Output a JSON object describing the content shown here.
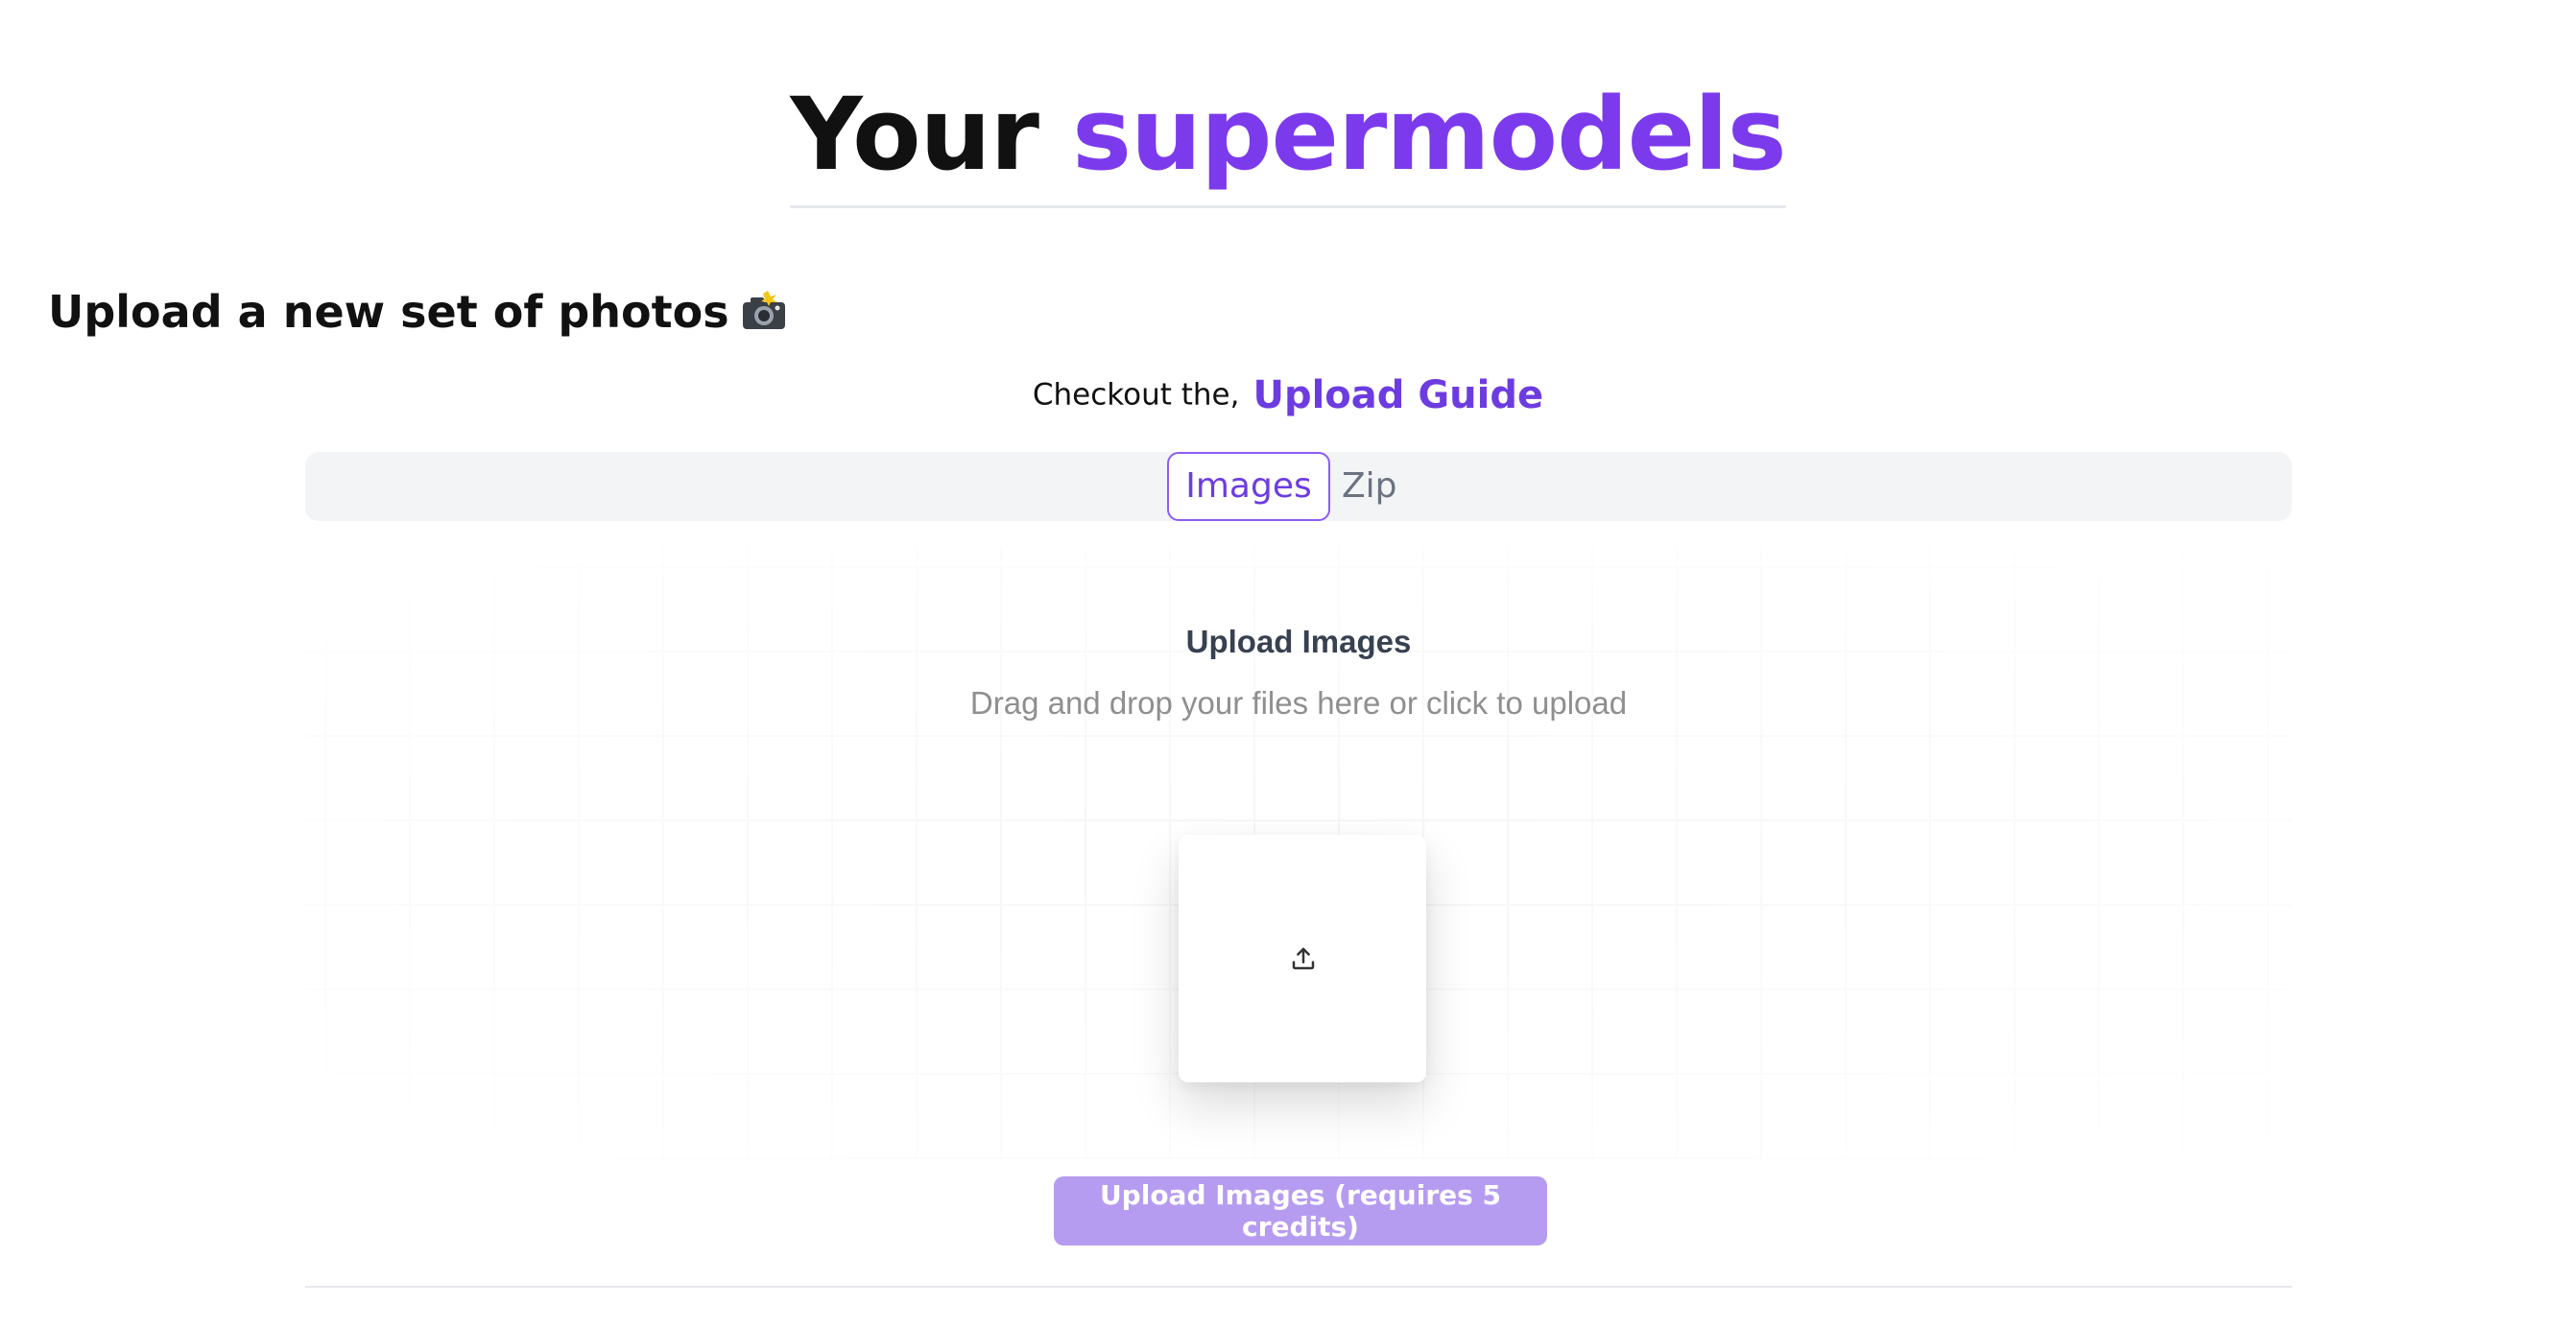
{
  "header": {
    "title_prefix": "Your",
    "title_accent": "supermodels"
  },
  "upload_section": {
    "heading": "Upload a new set of photos",
    "heading_icon": "camera-with-flash-icon",
    "guide_prefix": "Checkout the,",
    "guide_link": "Upload Guide"
  },
  "tabs": [
    {
      "label": "Images",
      "active": true
    },
    {
      "label": "Zip",
      "active": false
    }
  ],
  "dropzone": {
    "title": "Upload Images",
    "subtitle": "Drag and drop your files here or click to upload",
    "icon": "upload-icon"
  },
  "submit_button": {
    "label": "Upload Images (requires 5 credits)"
  },
  "colors": {
    "accent": "#6d3ce1",
    "accent_light": "#b69cf0",
    "tab_bar_bg": "#f3f4f6",
    "text": "#111111"
  }
}
